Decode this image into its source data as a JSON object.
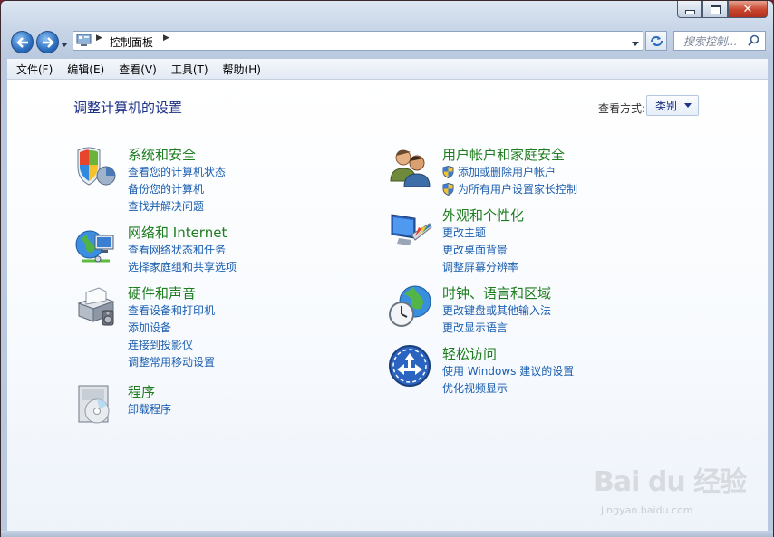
{
  "window": {
    "caption_buttons": [
      "minimize",
      "maximize",
      "close"
    ]
  },
  "nav": {
    "address_path": [
      "控制面板"
    ],
    "search_placeholder": "搜索控制..."
  },
  "menu": [
    "文件(F)",
    "编辑(E)",
    "查看(V)",
    "工具(T)",
    "帮助(H)"
  ],
  "content": {
    "heading": "调整计算机的设置",
    "view_by_label": "查看方式:",
    "view_by_value": "类别",
    "categories": [
      {
        "title": "系统和安全",
        "icon": "security-shield-icon",
        "links": [
          "查看您的计算机状态",
          "备份您的计算机",
          "查找并解决问题"
        ]
      },
      {
        "title": "网络和 Internet",
        "icon": "network-globe-icon",
        "links": [
          "查看网络状态和任务",
          "选择家庭组和共享选项"
        ]
      },
      {
        "title": "硬件和声音",
        "icon": "printer-speaker-icon",
        "links": [
          "查看设备和打印机",
          "添加设备",
          "连接到投影仪",
          "调整常用移动设置"
        ]
      },
      {
        "title": "程序",
        "icon": "program-disc-icon",
        "links": [
          "卸载程序"
        ]
      },
      {
        "title": "用户帐户和家庭安全",
        "icon": "users-icon",
        "links": [
          "添加或删除用户帐户",
          "为所有用户设置家长控制"
        ]
      },
      {
        "title": "外观和个性化",
        "icon": "display-palette-icon",
        "links": [
          "更改主题",
          "更改桌面背景",
          "调整屏幕分辨率"
        ]
      },
      {
        "title": "时钟、语言和区域",
        "icon": "clock-globe-icon",
        "links": [
          "更改键盘或其他输入法",
          "更改显示语言"
        ]
      },
      {
        "title": "轻松访问",
        "icon": "ease-of-access-icon",
        "links": [
          "使用 Windows 建议的设置",
          "优化视频显示"
        ]
      }
    ]
  },
  "watermark": {
    "text": "Bai du 经验",
    "url_text": "jingyan.baidu.com"
  }
}
